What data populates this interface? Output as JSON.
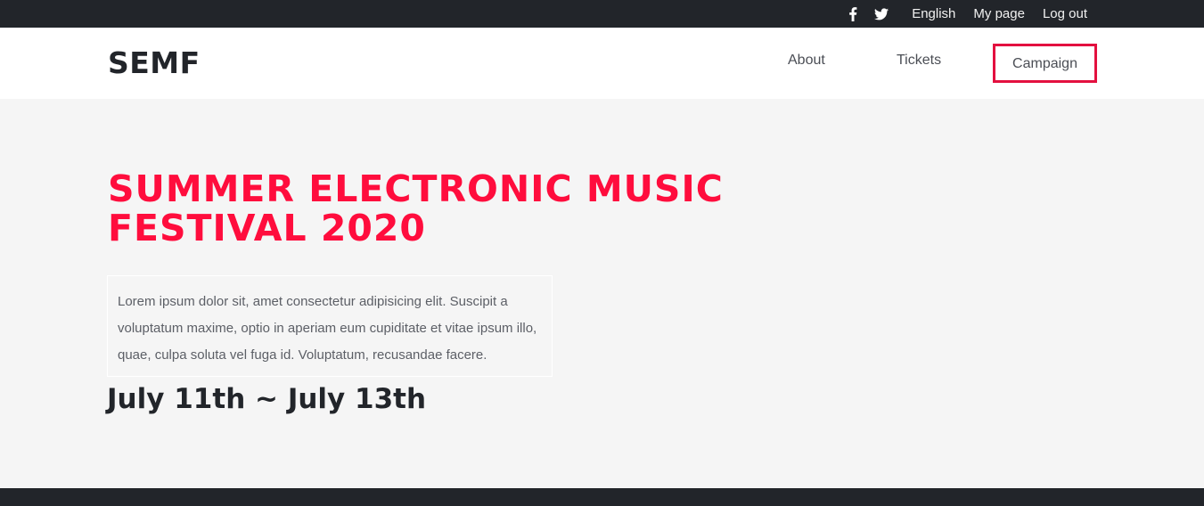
{
  "topbar": {
    "icons": [
      "facebook-icon",
      "twitter-icon"
    ],
    "language": "English",
    "my_page": "My page",
    "logout": "Log out"
  },
  "header": {
    "logo": "SEMF",
    "nav": {
      "about": "About",
      "tickets": "Tickets",
      "campaign": "Campaign"
    },
    "active_outline_color": "#e3103f"
  },
  "hero": {
    "title": "SUMMER ELECTRONIC MUSIC FESTIVAL 2020",
    "description": "Lorem ipsum dolor sit, amet consectetur adipisicing elit. Suscipit a voluptatum maxime, optio in aperiam eum cupiditate et vitae ipsum illo, quae, culpa soluta vel fuga id. Voluptatum, recusandae facere.",
    "dates": "July 11th ~ July 13th",
    "title_color": "#ff0d3d"
  },
  "colors": {
    "dark": "#22252a",
    "background": "#f5f5f5"
  }
}
